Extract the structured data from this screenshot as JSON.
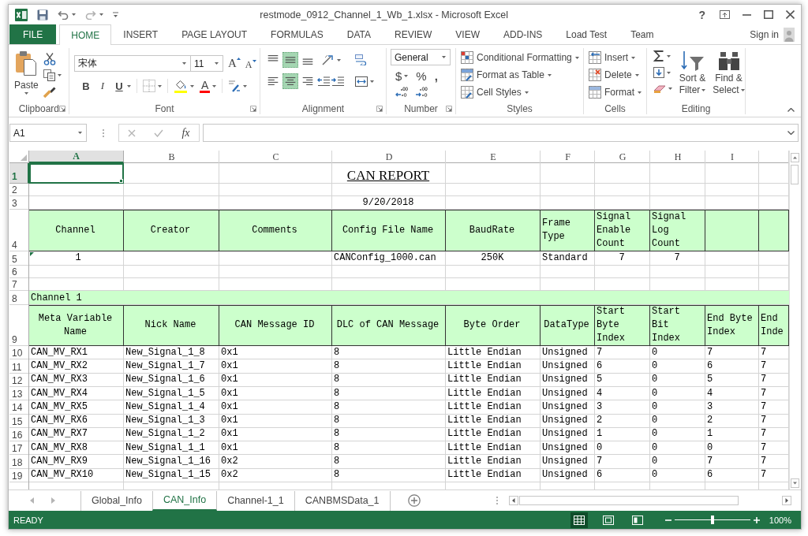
{
  "title_bar": {
    "title": "restmode_0912_Channel_1_Wb_1.xlsx - Microsoft Excel",
    "help": "?"
  },
  "ribbon_tabs": [
    {
      "label": "FILE",
      "kind": "file",
      "selected": false
    },
    {
      "label": "HOME",
      "kind": "tab",
      "selected": true
    },
    {
      "label": "INSERT",
      "kind": "tab",
      "selected": false
    },
    {
      "label": "PAGE LAYOUT",
      "kind": "tab",
      "selected": false
    },
    {
      "label": "FORMULAS",
      "kind": "tab",
      "selected": false
    },
    {
      "label": "DATA",
      "kind": "tab",
      "selected": false
    },
    {
      "label": "REVIEW",
      "kind": "tab",
      "selected": false
    },
    {
      "label": "VIEW",
      "kind": "tab",
      "selected": false
    },
    {
      "label": "ADD-INS",
      "kind": "tab",
      "selected": false
    },
    {
      "label": "Load Test",
      "kind": "tab",
      "selected": false
    },
    {
      "label": "Team",
      "kind": "tab",
      "selected": false
    }
  ],
  "sign_in": "Sign in",
  "ribbon": {
    "clipboard": {
      "label": "Clipboard",
      "paste": "Paste"
    },
    "font": {
      "label": "Font",
      "font_name": "宋体",
      "font_size": "11",
      "grow_font": "A",
      "shrink_font": "A",
      "styles": [
        {
          "label": "B",
          "kind": "bold"
        },
        {
          "label": "I",
          "kind": "italic"
        },
        {
          "label": "U",
          "kind": "underline"
        }
      ],
      "font_color": "A"
    },
    "alignment": {
      "label": "Alignment",
      "vertical": [
        {
          "kind": "top",
          "selected": false
        },
        {
          "kind": "middle",
          "selected": true
        },
        {
          "kind": "bottom",
          "selected": false
        }
      ],
      "horizontal": [
        {
          "kind": "left",
          "selected": false
        },
        {
          "kind": "center",
          "selected": true
        },
        {
          "kind": "right",
          "selected": false
        }
      ]
    },
    "number": {
      "label": "Number",
      "format": "General",
      "currency": "$",
      "percent": "%",
      "comma": ","
    },
    "styles": {
      "label": "Styles",
      "buttons": [
        {
          "label": "Conditional Formatting",
          "kind": "conditional"
        },
        {
          "label": "Format as Table",
          "kind": "table"
        },
        {
          "label": "Cell Styles",
          "kind": "cell_styles"
        }
      ]
    },
    "cells": {
      "label": "Cells",
      "buttons": [
        {
          "label": "Insert",
          "kind": "insert"
        },
        {
          "label": "Delete",
          "kind": "delete"
        },
        {
          "label": "Format",
          "kind": "format"
        }
      ]
    },
    "editing": {
      "label": "Editing",
      "sort_filter": "Sort & Filter",
      "find_select": "Find & Select"
    }
  },
  "formula_bar": {
    "name_box": "A1",
    "insert_function": "fx",
    "editing": false
  },
  "sheet": {
    "column_headers": [
      {
        "label": "A",
        "selected": true
      },
      {
        "label": "B",
        "selected": false
      },
      {
        "label": "C",
        "selected": false
      },
      {
        "label": "D",
        "selected": false
      },
      {
        "label": "E",
        "selected": false
      },
      {
        "label": "F",
        "selected": false
      },
      {
        "label": "G",
        "selected": false
      },
      {
        "label": "H",
        "selected": false
      },
      {
        "label": "I",
        "selected": false
      }
    ],
    "rows": [
      {
        "number": "1",
        "selected": true,
        "kind": "title",
        "text": "CAN REPORT"
      },
      {
        "number": "2",
        "selected": false,
        "kind": "blank"
      },
      {
        "number": "3",
        "selected": false,
        "kind": "date",
        "text": "9/20/2018"
      },
      {
        "number": "4",
        "selected": false,
        "kind": "summary_header",
        "channel": "Channel",
        "creator": "Creator",
        "comments": "Comments",
        "config_file_name": "Config File Name",
        "baud_rate": "BaudRate",
        "frame_type": "Frame Type",
        "signal_enable_count": "Signal Enable Count",
        "signal_log_count": "Signal Log Count"
      },
      {
        "number": "5",
        "selected": false,
        "kind": "summary_row",
        "error_indicator": true,
        "channel": "1",
        "config_file_name": "CANConfig_1000.can",
        "baud_rate": "250K",
        "frame_type": "Standard",
        "signal_enable_count": "7",
        "signal_log_count": "7"
      },
      {
        "number": "6",
        "selected": false,
        "kind": "blank"
      },
      {
        "number": "7",
        "selected": false,
        "kind": "blank"
      },
      {
        "number": "8",
        "selected": false,
        "kind": "section_title",
        "text": "Channel 1"
      },
      {
        "number": "9",
        "selected": false,
        "kind": "signal_header",
        "cells": [
          "Meta Variable Name",
          "Nick Name",
          "CAN Message ID",
          "DLC of CAN Message",
          "Byte Order",
          "DataType",
          "Start Byte Index",
          "Start Bit Index",
          "End Byte Index",
          "End Inde"
        ]
      },
      {
        "number": "10",
        "selected": false,
        "kind": "signal_row",
        "cells": [
          "CAN_MV_RX1",
          "New_Signal_1_8",
          "0x1",
          "8",
          "Little Endian",
          "Unsigned",
          "7",
          "0",
          "7",
          "7"
        ]
      },
      {
        "number": "11",
        "selected": false,
        "kind": "signal_row",
        "cells": [
          "CAN_MV_RX2",
          "New_Signal_1_7",
          "0x1",
          "8",
          "Little Endian",
          "Unsigned",
          "6",
          "0",
          "6",
          "7"
        ]
      },
      {
        "number": "12",
        "selected": false,
        "kind": "signal_row",
        "cells": [
          "CAN_MV_RX3",
          "New_Signal_1_6",
          "0x1",
          "8",
          "Little Endian",
          "Unsigned",
          "5",
          "0",
          "5",
          "7"
        ]
      },
      {
        "number": "13",
        "selected": false,
        "kind": "signal_row",
        "cells": [
          "CAN_MV_RX4",
          "New_Signal_1_5",
          "0x1",
          "8",
          "Little Endian",
          "Unsigned",
          "4",
          "0",
          "4",
          "7"
        ]
      },
      {
        "number": "14",
        "selected": false,
        "kind": "signal_row",
        "cells": [
          "CAN_MV_RX5",
          "New_Signal_1_4",
          "0x1",
          "8",
          "Little Endian",
          "Unsigned",
          "3",
          "0",
          "3",
          "7"
        ]
      },
      {
        "number": "15",
        "selected": false,
        "kind": "signal_row",
        "cells": [
          "CAN_MV_RX6",
          "New_Signal_1_3",
          "0x1",
          "8",
          "Little Endian",
          "Unsigned",
          "2",
          "0",
          "2",
          "7"
        ]
      },
      {
        "number": "16",
        "selected": false,
        "kind": "signal_row",
        "cells": [
          "CAN_MV_RX7",
          "New_Signal_1_2",
          "0x1",
          "8",
          "Little Endian",
          "Unsigned",
          "1",
          "0",
          "1",
          "7"
        ]
      },
      {
        "number": "17",
        "selected": false,
        "kind": "signal_row",
        "cells": [
          "CAN_MV_RX8",
          "New_Signal_1_1",
          "0x1",
          "8",
          "Little Endian",
          "Unsigned",
          "0",
          "0",
          "0",
          "7"
        ]
      },
      {
        "number": "18",
        "selected": false,
        "kind": "signal_row",
        "cells": [
          "CAN_MV_RX9",
          "New_Signal_1_16",
          "0x2",
          "8",
          "Little Endian",
          "Unsigned",
          "7",
          "0",
          "7",
          "7"
        ]
      },
      {
        "number": "19",
        "selected": false,
        "kind": "signal_row",
        "cells": [
          "CAN_MV_RX10",
          "New_Signal_1_15",
          "0x2",
          "8",
          "Little Endian",
          "Unsigned",
          "6",
          "0",
          "6",
          "7"
        ]
      }
    ]
  },
  "sheet_tabs": [
    {
      "label": "Global_Info",
      "selected": false
    },
    {
      "label": "CAN_Info",
      "selected": true
    },
    {
      "label": "Channel-1_1",
      "selected": false
    },
    {
      "label": "CANBMSData_1",
      "selected": false
    }
  ],
  "status_bar": {
    "mode": "READY",
    "views": [
      {
        "kind": "normal",
        "selected": true
      },
      {
        "kind": "page_layout",
        "selected": false
      },
      {
        "kind": "page_break",
        "selected": false
      }
    ],
    "zoom": {
      "level": 0.5,
      "reading": "100%"
    }
  }
}
